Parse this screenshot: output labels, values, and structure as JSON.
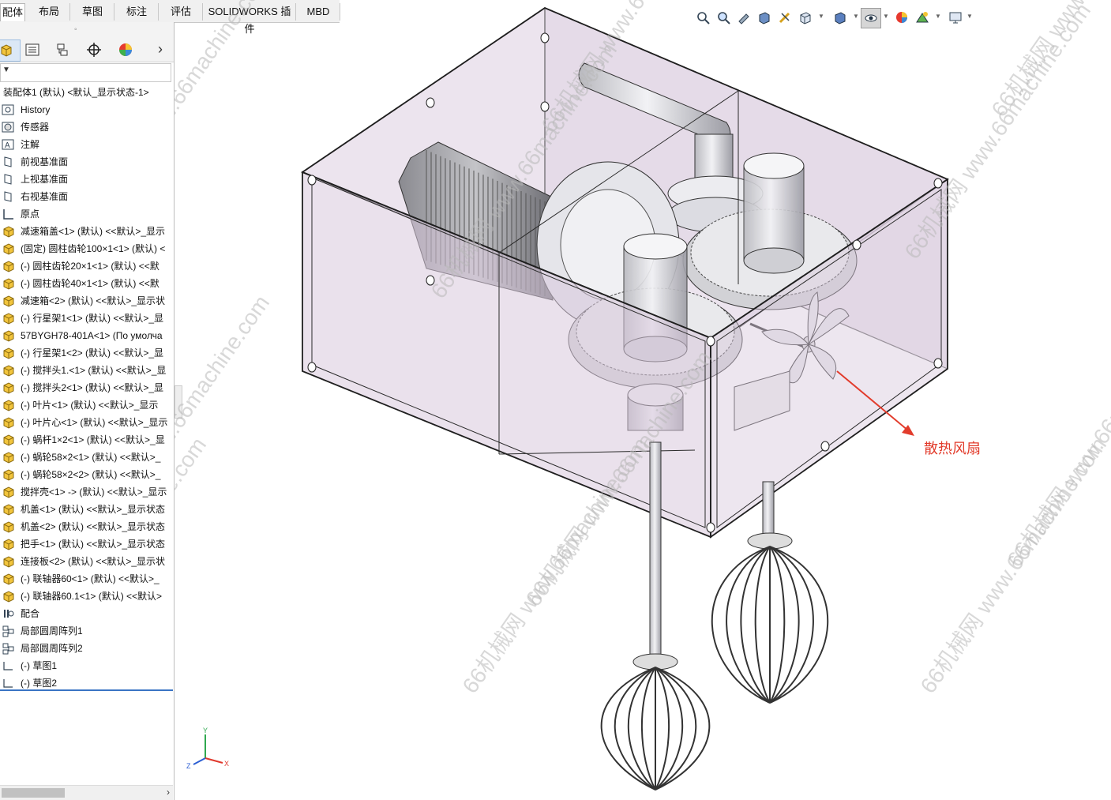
{
  "tabs": [
    "配体",
    "布局",
    "草图",
    "标注",
    "评估",
    "SOLIDWORKS 插件",
    "MBD"
  ],
  "active_tab_index": 0,
  "panel": {
    "collapse_glyph": "◦",
    "tab_icons": [
      "feature-manager-icon",
      "property-manager-icon",
      "configuration-manager-icon",
      "dimxpert-icon",
      "display-manager-icon"
    ],
    "more_glyph": "›",
    "filter_glyph": "▼"
  },
  "tree": [
    {
      "label": "装配体1 (默认) <默认_显示状态-1>",
      "icon": "assembly-root"
    },
    {
      "label": "History",
      "icon": "history-icon"
    },
    {
      "label": "传感器",
      "icon": "sensor-icon"
    },
    {
      "label": "注解",
      "icon": "annotation-icon"
    },
    {
      "label": "前视基准面",
      "icon": "plane-icon"
    },
    {
      "label": "上视基准面",
      "icon": "plane-icon"
    },
    {
      "label": "右视基准面",
      "icon": "plane-icon"
    },
    {
      "label": "原点",
      "icon": "origin-icon"
    },
    {
      "label": "减速箱盖<1> (默认) <<默认>_显示",
      "icon": "part-icon"
    },
    {
      "label": "(固定) 圆柱齿轮100×1<1> (默认) <",
      "icon": "part-icon"
    },
    {
      "label": "(-) 圆柱齿轮20×1<1> (默认) <<默",
      "icon": "part-icon"
    },
    {
      "label": "(-) 圆柱齿轮40×1<1> (默认) <<默",
      "icon": "part-icon"
    },
    {
      "label": "减速箱<2> (默认) <<默认>_显示状",
      "icon": "part-icon"
    },
    {
      "label": "(-) 行星架1<1> (默认) <<默认>_显",
      "icon": "part-icon"
    },
    {
      "label": "57BYGH78-401A<1> (По умолча",
      "icon": "part-icon"
    },
    {
      "label": "(-) 行星架1<2> (默认) <<默认>_显",
      "icon": "part-icon"
    },
    {
      "label": "(-) 搅拌头1.<1> (默认) <<默认>_显",
      "icon": "part-icon"
    },
    {
      "label": "(-) 搅拌头2<1> (默认) <<默认>_显",
      "icon": "part-icon"
    },
    {
      "label": "(-) 叶片<1> (默认) <<默认>_显示",
      "icon": "part-icon"
    },
    {
      "label": "(-) 叶片心<1> (默认) <<默认>_显示",
      "icon": "part-icon"
    },
    {
      "label": "(-) 蜗杆1×2<1> (默认) <<默认>_显",
      "icon": "part-icon"
    },
    {
      "label": "(-) 蜗轮58×2<1> (默认) <<默认>_",
      "icon": "part-icon"
    },
    {
      "label": "(-) 蜗轮58×2<2> (默认) <<默认>_",
      "icon": "part-icon"
    },
    {
      "label": "搅拌壳<1> -> (默认) <<默认>_显示",
      "icon": "part-icon"
    },
    {
      "label": "机盖<1> (默认) <<默认>_显示状态",
      "icon": "part-icon"
    },
    {
      "label": "机盖<2> (默认) <<默认>_显示状态",
      "icon": "part-icon"
    },
    {
      "label": "把手<1> (默认) <<默认>_显示状态",
      "icon": "part-icon"
    },
    {
      "label": "连接板<2> (默认) <<默认>_显示状",
      "icon": "part-icon"
    },
    {
      "label": "(-) 联轴器60<1> (默认) <<默认>_",
      "icon": "part-icon"
    },
    {
      "label": "(-) 联轴器60.1<1> (默认) <<默认>",
      "icon": "part-icon"
    },
    {
      "label": "配合",
      "icon": "mates-icon"
    },
    {
      "label": "局部圆周阵列1",
      "icon": "pattern-icon"
    },
    {
      "label": "局部圆周阵列2",
      "icon": "pattern-icon"
    },
    {
      "label": "(-) 草图1",
      "icon": "sketch-icon"
    },
    {
      "label": "(-) 草图2",
      "icon": "sketch-icon"
    }
  ],
  "hud_icons": [
    "zoom-to-fit-icon",
    "zoom-to-area-icon",
    "previous-view-icon",
    "section-view-icon",
    "dynamic-annotation-icon",
    "view-orientation-icon",
    "display-style-icon",
    "hide-show-items-icon",
    "edit-appearance-icon",
    "apply-scene-icon",
    "view-settings-icon"
  ],
  "callout": {
    "text": "散热风扇",
    "color": "#e23c2c"
  },
  "watermark": "66机械网 www.66machine.com",
  "triad": {
    "x": "X",
    "y": "Y",
    "z": "Z"
  },
  "colors": {
    "housing_fill": "#d8c8dc",
    "edge": "#202020",
    "gear": "#c8c8c8"
  }
}
